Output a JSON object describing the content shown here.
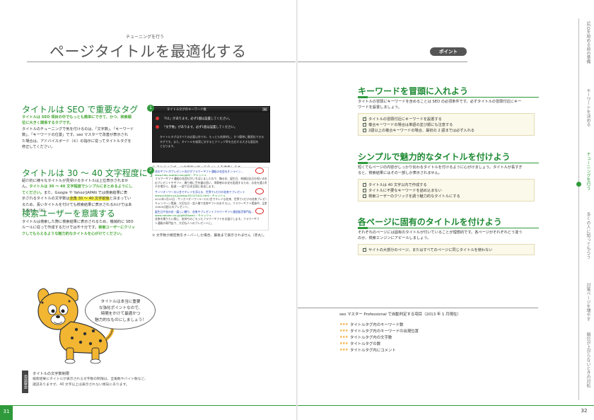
{
  "header": {
    "kicker": "チューニングを行う",
    "title": "ページタイトルを最適化する",
    "point_badge": "ポイント"
  },
  "left": {
    "sec1": {
      "heading": "タイトルは SEO で重要なタグ",
      "lines": [
        {
          "hl": "タイトルは SEO 項目の中でもっとも簡単にできて、かつ、検索順",
          "n": ""
        },
        {
          "hl": "位に大きく関係するタグです。",
          "n": ""
        },
        {
          "hl": "",
          "n": "タイトルのチューニングで気を付けるのは、「文字数」、「キーワード"
        },
        {
          "hl": "",
          "n": "数」、「キーワードの位置」です。seo マスターで改善が表示され"
        },
        {
          "hl": "",
          "n": "た場合は、アドバイスボード（①）の指示に従ってタイトルタグを"
        },
        {
          "hl": "",
          "n": "修正してください。"
        }
      ]
    },
    "sec2": {
      "heading": "タイトルは 30 ～ 40 文字程度にする",
      "l1": "紹介的に様々なタイトルが見受けるタイトルは上位表示されませ",
      "l2a": "ん。",
      "l2b": "タイトルは 30 ～ 40 文字程度でシンプルにまとめるようにし",
      "l3a": "てください。",
      "l3b": "また、Google や Yahoo!JAPAN では検索結果に表",
      "l4a": "示されるタイトルの文字数は",
      "l4b": "全角 30 ～ 40 文字前後",
      "l4c": "と決まってい",
      "l5": "るため、長いタイトルを付けても検索結果に表示されるわけではあ",
      "l6": "りません（②）。"
    },
    "sec3": {
      "heading": "検索ユーザーを意識する",
      "l1": "タイトルは検索した際に検索結果に表示されるため、機械的に SEO",
      "l2a": "ルールに従って作成するだけでは不十分です。",
      "l2b": "検索ユーザーにクリッ",
      "l3": "クしてもらえるような魅力的なタイトルを心がけてください。"
    },
    "advice_board": {
      "title": "タイトルタグのキーワード数",
      "items": [
        {
          "n": "1",
          "text": "「h1」があります。必ず1個は設置してください。"
        },
        {
          "n": "2",
          "text": "「文字数」があります。必ず1個は設置してください。"
        }
      ],
      "desc": [
        "タイトルタグはすべての必要以外での、もっとも効果的に、かつ簡単に最適化できる",
        "タグです。また、タイトルを検索に対するとクリック率を左右する大きな要因を",
        "となります。"
      ],
      "caption": "① アドバイスボードの指示に従ってタイトルを改善します。"
    },
    "search_results": {
      "items": [
        {
          "title": "花のギフトがプレゼント向けがフラワーギフト通販の花会社オンライン...",
          "url": "www.hibu-ssatier.com/gift/・キャッシュ",
          "desc": [
            "フラワーギフト通販の花会社がいちはじましたので、胸る花、誕生日、結婚記念日お祝いの花",
            "のプレゼントやギフト、贈り物に手作業の思い、季節感のお花を配達するため、お花を選ぶ際にも",
            "その場から、配達・一部で日本全国に発送します。"
          ]
        },
        {
          "title": "サンリオーワ一口い言でキレイを添える、世界で1だけの花束でプレゼント",
          "url": "www.sukkery.co.jp/www/2012/1001.html・キャッシュ",
          "desc": [
            "2012年1月10日 - サンカリオーワール一口い言でキレイな花束、世界で1だけの花束プレゼント",
            "キャンペーン実施、大切な方・恋人様で花束ギフトのおそろい。フラワーギフト実施中、品数",
            "10000点超えのプレゼント。"
          ]
        },
        {
          "title": "誕生日や花の花・嬉しい贈り、花束やプレゼントフラワーギフト通信販売専門店...",
          "url": "www.rakuten.ne.jp/gift/flower/・キャッシュ",
          "desc": [
            "花束を贈りたい際に、気持ちのこもったフラワーギフトをお届けします。フラワーギフ",
            "ト通販の専門店で、大切な人へのプレゼントに。"
          ]
        }
      ],
      "caption": "② 文字数が規定数をオーバーした場合、最後まで表示されません（赤丸）。"
    },
    "bubble": [
      "タイトルは本当に重要",
      "な強化ポイントなので、",
      "時間をかけて最適かつ",
      "魅力的なものにしましょう！"
    ],
    "glossary": {
      "label": "用語解説",
      "title": "タイトルの文字数制限",
      "lines": [
        "検索結果にタイトルが表示される文字数の制限は、全角数やバイト数など、",
        "諸説ありますが、40 文字以上は表示されない傾向にあります。"
      ]
    },
    "page_number": "31"
  },
  "right": {
    "sections": [
      {
        "heading": "キーワードを冒頭に入れよう",
        "text": [
          "タイトルの冒頭にキーワードを含めることは SEO の必須条件です。必ずタイトルの冒頭付近にキー",
          "ワードを設置しましょう。"
        ],
        "bold_start": 35,
        "bold_end": 56,
        "checks": [
          "タイトルの冒頭付近にキーワードを設置する",
          "複合キーワードの場合は単語の並び順にも注意する",
          "2語以上の複合キーワードの場合、最初の 2 語までは必ず入れる"
        ]
      },
      {
        "heading": "シンプルで魅力的なタイトルを付けよう",
        "text": [
          "短くてもページの内容がしっかり伝わるタイトルを付けるように心がけましょう。タイトルが長すぎ",
          "ると、検索結果にはその一部しか表示されません。"
        ],
        "checks": [
          "タイトルは 40 文字以内で作成する",
          "タイトルに不要なキーワードを詰め込まない",
          "検索ユーザーのクリックを誘う魅力的なタイトルにする"
        ]
      },
      {
        "heading": "各ページに固有のタイトルを付けよう",
        "text": [
          "それぞれのページには固有のタイトルが付いていることが理想的です。各ページがそれぞれどう違う",
          "のか、検索エンジンにアピールしましょう。"
        ],
        "checks": [
          "サイトの大部分のページ、またはすべてのページに同じタイトルを使わない"
        ]
      }
    ],
    "score": {
      "title": "seo マスター Professional で自動判定する項目（2013 年 1 月現在）",
      "items": [
        {
          "stars": "★★★",
          "label": "タイトルタグ内のキーワード数"
        },
        {
          "stars": "★★★",
          "label": "タイトルタグ内のキーワードの出現位置"
        },
        {
          "stars": "★★★",
          "label": "タイトルタグ内の文字数"
        },
        {
          "stars": "★★★",
          "label": "タイトルタグの数"
        },
        {
          "stars": "★★★",
          "label": "タイトルタグ内にコメント"
        }
      ]
    },
    "side_tabs": [
      "SEOを始める前の準備",
      "キーワードを決める",
      "チューニングを行う",
      "多くの人に知ってもらう",
      "対策ページを増やす",
      "順位が上がらないときの対処"
    ],
    "active_tab": "チューニングを行う",
    "page_number": "32"
  },
  "colors": {
    "accent_green": "#2f9a3b",
    "heading_green": "#1d8a33",
    "highlight_yellow": "#f4ef4a",
    "box_bg": "#fbf9ea"
  }
}
